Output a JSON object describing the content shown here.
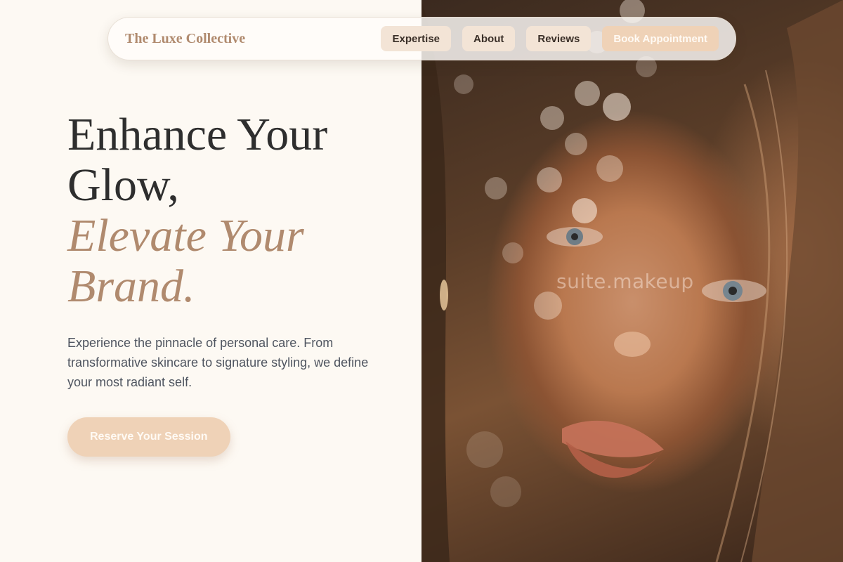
{
  "nav": {
    "brand": "The Luxe Collective",
    "links": [
      "Expertise",
      "About",
      "Reviews"
    ],
    "cta_label": "Book Appointment"
  },
  "hero": {
    "headline_line1": "Enhance Your",
    "headline_line2": "Glow,",
    "headline_accent1": "Elevate Your",
    "headline_accent2": "Brand.",
    "description": "Experience the pinnacle of personal care. From transformative skincare to signature styling, we define your most radiant self.",
    "cta_label": "Reserve Your Session"
  },
  "photo": {
    "watermark": "suite.makeup",
    "subject": "close-up portrait of a freckled woman with auburn hair behind bokeh light"
  },
  "colors": {
    "background": "#fdf9f3",
    "accent": "#b08a6e",
    "button_fill": "#efd2b7",
    "nav_pill": "#f3e4d6",
    "headline": "#2e2e2e",
    "body_text": "#4f5560"
  }
}
